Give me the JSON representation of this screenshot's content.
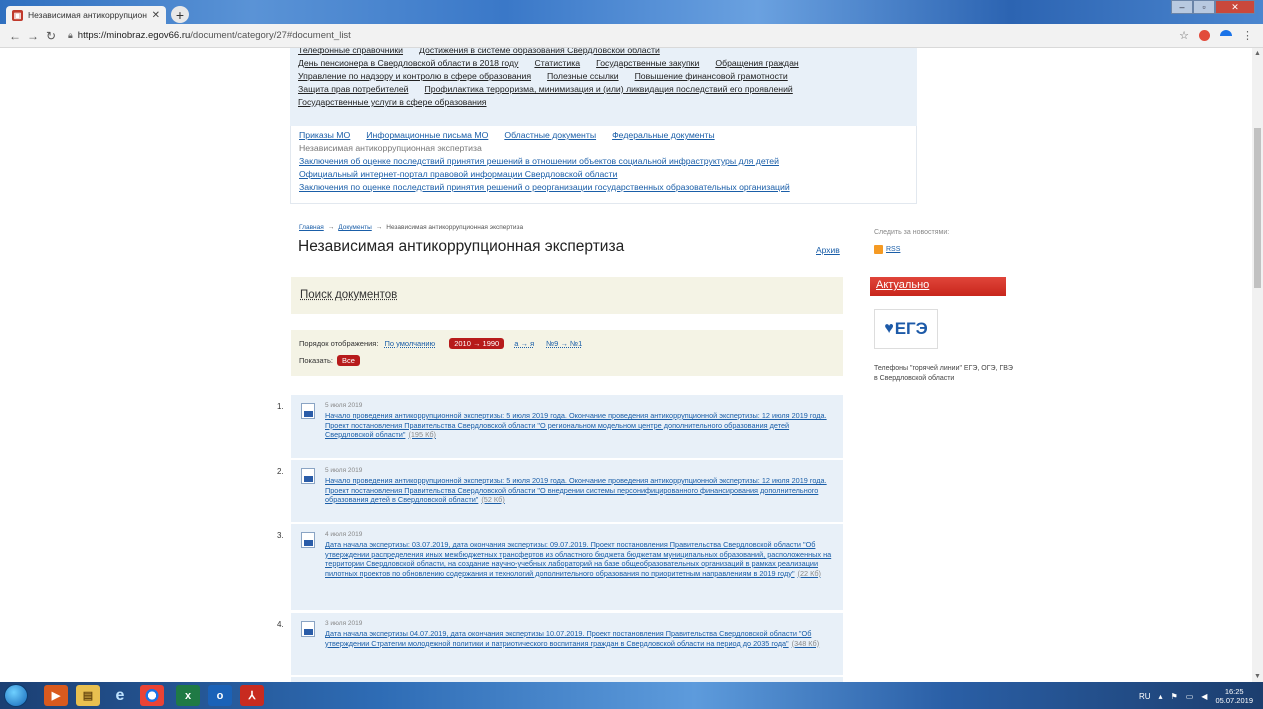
{
  "browser": {
    "tab_title": "Независимая антикоррупцион",
    "url_host": "https://minobraz.egov66.ru",
    "url_path": "/document/category/27#document_list"
  },
  "topnav": {
    "row1": [
      "Телефонные справочники",
      "Достижения в системе образования Свердловской области"
    ],
    "row2": [
      "День пенсионера в Свердловской области в 2018 году",
      "Статистика",
      "Государственные закупки",
      "Обращения граждан"
    ],
    "row3": [
      "Управление по надзору и контролю в сфере образования",
      "Полезные ссылки",
      "Повышение финансовой грамотности"
    ],
    "row4": [
      "Защита прав потребителей",
      "Профилактика терроризма, минимизация и (или) ликвидация последствий его проявлений"
    ],
    "row5": [
      "Государственные услуги в сфере образования"
    ]
  },
  "subnav": {
    "tabs": [
      "Приказы МО",
      "Информационные письма МО",
      "Областные документы",
      "Федеральные документы"
    ],
    "current": "Независимая антикоррупционная экспертиза",
    "links": [
      "Заключения об оценке последствий принятия решений в отношении объектов социальной инфраструктуры для детей",
      "Официальный интернет-портал правовой информации Свердловской области",
      "Заключения по оценке последствий принятия решений о реорганизации государственных образовательных организаций"
    ]
  },
  "breadcrumb": {
    "home": "Главная",
    "sep": "→",
    "docs": "Документы",
    "current": "Независимая антикоррупционная экспертиза"
  },
  "page_title": "Независимая антикоррупционная экспертиза",
  "archive_link": "Архив",
  "sidebar": {
    "follow": "Следить за новостями:",
    "rss": "RSS",
    "actual_title": "Актуально",
    "ege_logo": "ЕГЭ",
    "ege_caption": "Телефоны \"горячей линии\" ЕГЭ, ОГЭ, ГВЭ в Свердловской области"
  },
  "search": {
    "title": "Поиск документов"
  },
  "order": {
    "label": "Порядок отображения:",
    "default": "По умолчанию",
    "year_range": "2010 → 1990",
    "alpha": "а → я",
    "number": "№9 → №1",
    "show_label": "Показать:",
    "show_all": "Все"
  },
  "documents": [
    {
      "num": "1.",
      "date": "5 июля 2019",
      "text": "Начало проведения антикоррупционной экспертизы: 5 июля 2019 года. Окончание проведения антикоррупционной экспертизы: 12 июля 2019 года. Проект постановления Правительства Свердловской области \"О региональном модельном центре дополнительного образования детей Свердловской области\"",
      "size": "(195 Кб)"
    },
    {
      "num": "2.",
      "date": "5 июля 2019",
      "text": "Начало проведения антикоррупционной экспертизы: 5 июля 2019 года. Окончание проведения антикоррупционной экспертизы: 12 июля 2019 года. Проект постановления Правительства Свердловской области \"О внедрении системы персонифицированного финансирования дополнительного образования детей в Свердловской области\"",
      "size": "(52 Кб)"
    },
    {
      "num": "3.",
      "date": "4 июля 2019",
      "text": "Дата начала экспертизы: 03.07.2019, дата окончания экспертизы: 09.07.2019. Проект постановления Правительства Свердловской области \"Об утверждении распределения иных межбюджетных трансфертов из областного бюджета бюджетам муниципальных образований, расположенных на территории Свердловской области, на создание научно-учебных лабораторий на базе общеобразовательных организаций в рамках реализации пилотных проектов по обновлению содержания и технологий дополнительного образования по приоритетным направлениям в 2019 году\"",
      "size": "(22 Кб)"
    },
    {
      "num": "4.",
      "date": "3 июля 2019",
      "text": "Дата начала экспертизы 04.07.2019, дата окончания экспертизы 10.07.2019. Проект постановления Правительства Свердловской области \"Об утверждении Стратегии молодежной политики и патриотического воспитания граждан в Свердловской области на период до 2035 года\"",
      "size": "(348 Кб)"
    }
  ],
  "taskbar": {
    "lang": "RU",
    "time": "16:25",
    "date": "05.07.2019"
  }
}
